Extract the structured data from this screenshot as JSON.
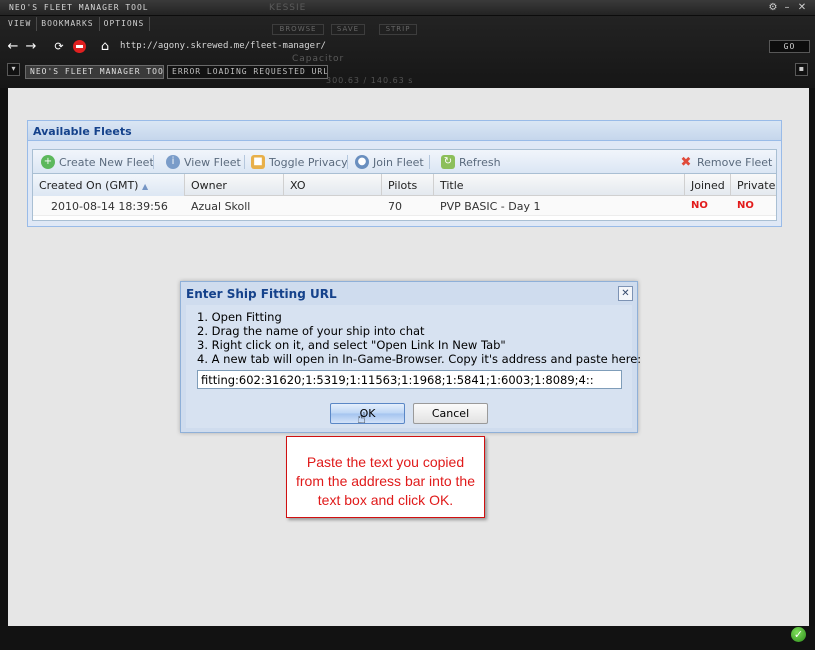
{
  "window": {
    "title": "NEO'S FLEET MANAGER TOOL",
    "background_labels": {
      "player_name": "KESSIE",
      "capacitor": "Capacitor",
      "stats": "300.63 / 140.63 s"
    },
    "dim_buttons": [
      "BROWSE",
      "SAVE",
      "STRIP"
    ]
  },
  "menu": {
    "items": [
      "VIEW",
      "BOOKMARKS",
      "OPTIONS"
    ]
  },
  "navbar": {
    "url": "http://agony.skrewed.me/fleet-manager/",
    "go_label": "GO"
  },
  "tabs": [
    {
      "label": "NEO'S FLEET MANAGER TOOL",
      "active": true
    },
    {
      "label": "ERROR LOADING REQUESTED URL",
      "active": false
    }
  ],
  "panel": {
    "title": "Available Fleets",
    "toolbar": {
      "create": "Create New Fleet",
      "view": "View Fleet",
      "privacy": "Toggle Privacy",
      "join": "Join Fleet",
      "refresh": "Refresh",
      "remove": "Remove Fleet"
    },
    "columns": {
      "created": "Created On (GMT)",
      "owner": "Owner",
      "xo": "XO",
      "pilots": "Pilots",
      "title": "Title",
      "joined": "Joined",
      "private": "Private"
    },
    "row": {
      "created": "2010-08-14 18:39:56",
      "owner": "Azual Skoll",
      "xo": "",
      "pilots": "70",
      "title": "PVP BASIC - Day 1",
      "joined": "NO",
      "private": "NO"
    }
  },
  "dialog": {
    "title": "Enter Ship Fitting URL",
    "steps": [
      "1. Open Fitting",
      "2. Drag the name of your ship into chat",
      "3. Right click on it, and select \"Open Link In New Tab\"",
      "4. A new tab will open in In-Game-Browser. Copy it's address and paste here:"
    ],
    "input_value": "fitting:602:31620;1:5319;1:11563;1:1968;1:5841;1:6003;1:8089;4::",
    "ok_label": "OK",
    "cancel_label": "Cancel"
  },
  "callout": {
    "text": "Paste the text you copied from the address bar into the text box and click OK."
  },
  "colors": {
    "panel_header_text": "#15428b",
    "flag_no": "#e21b1b",
    "callout_text": "#e01a1a",
    "status_ok": "#3aa51f"
  }
}
